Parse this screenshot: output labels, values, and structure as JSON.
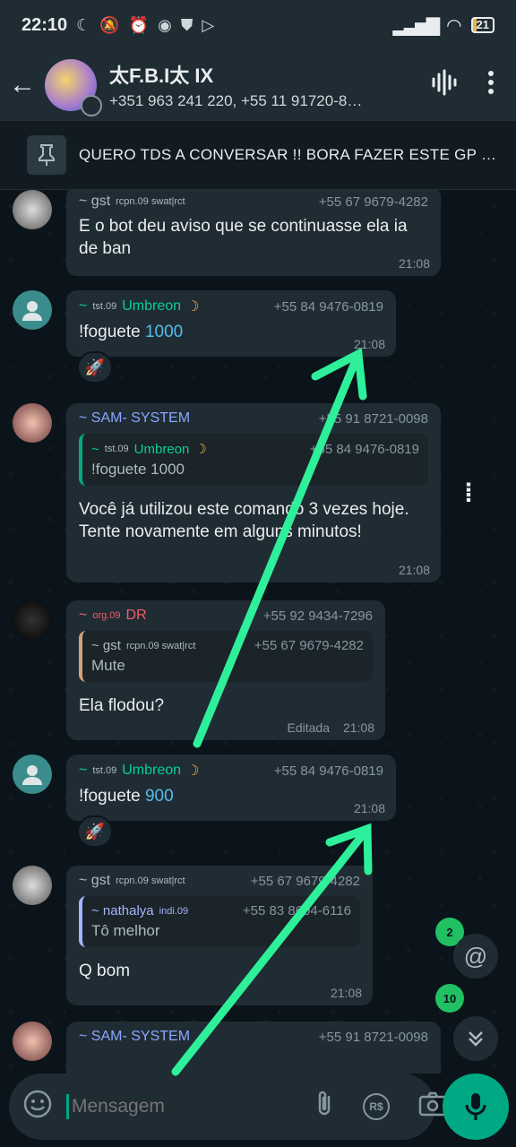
{
  "status_bar": {
    "time": "22:10",
    "battery": "21"
  },
  "header": {
    "group_name": "太F.B.I太 IX",
    "participants": "+351 963 241 220, +55 11 91720-8…"
  },
  "pinned": {
    "text": "QUERO TDS A CONVERSAR !! BORA FAZER ESTE GP S…"
  },
  "messages": [
    {
      "sender": "~ gst",
      "tag": "rcpn.09 swat|rct",
      "phone": "+55 67 9679-4282",
      "text": "E o bot deu aviso que se continuasse ela ia de ban",
      "time": "21:08"
    },
    {
      "sender": "Umbreon",
      "prefix": "~",
      "tag": "tst.09",
      "phone": "+55 84 9476-0819",
      "text_plain": "!foguete ",
      "text_link": "1000",
      "time": "21:08",
      "reaction": "🚀"
    },
    {
      "sender": "~ SAM- SYSTEM",
      "phone": "+55 91 8721-0098",
      "quote_sender": "Umbreon",
      "quote_tag": "tst.09",
      "quote_phone": "+55 84 9476-0819",
      "quote_text": "!foguete 1000",
      "text": "Você já utilizou este comando 3 vezes hoje. Tente novamente em alguns minutos!",
      "time": "21:08"
    },
    {
      "sender": "DR",
      "prefix": "~",
      "tag": "org.09",
      "phone": "+55 92 9434-7296",
      "quote_sender": "~ gst",
      "quote_tag": "rcpn.09 swat|rct",
      "quote_phone": "+55 67 9679-4282",
      "quote_text": "Mute",
      "text": "Ela flodou?",
      "edited": "Editada",
      "time": "21:08"
    },
    {
      "sender": "Umbreon",
      "prefix": "~",
      "tag": "tst.09",
      "phone": "+55 84 9476-0819",
      "text_plain": "!foguete ",
      "text_link": "900",
      "time": "21:08",
      "reaction": "🚀"
    },
    {
      "sender": "~ gst",
      "tag": "rcpn.09 swat|rct",
      "phone": "+55 67 9679-4282",
      "quote_sender": "~ nathalya",
      "quote_tag": "indi.09",
      "quote_phone": "+55 83 8604-6116",
      "quote_text": "Tô melhor",
      "text": "Q bom",
      "time": "21:08"
    },
    {
      "sender": "~ SAM- SYSTEM",
      "phone": "+55 91 8721-0098"
    }
  ],
  "floating": {
    "mentions_count": "2",
    "unread_count": "10"
  },
  "composer": {
    "placeholder": "Mensagem",
    "currency": "R$"
  },
  "colors": {
    "accent": "#00a884",
    "arrow": "#2ef09a"
  }
}
